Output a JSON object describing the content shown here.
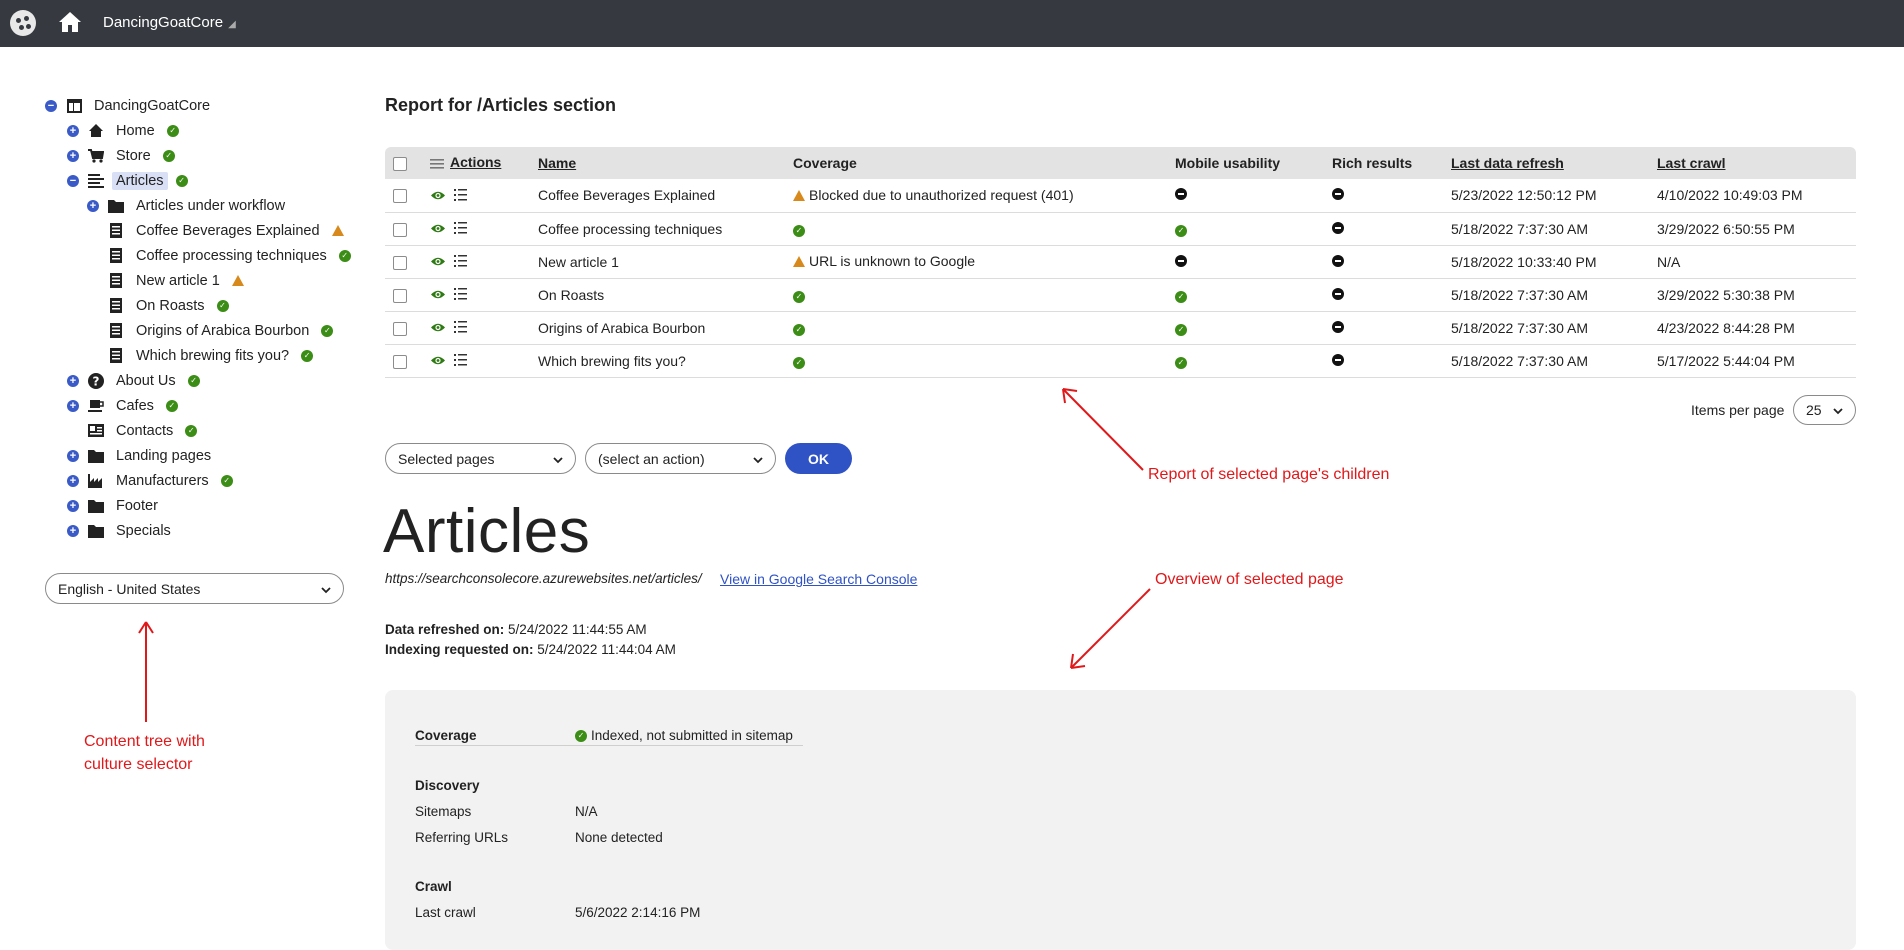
{
  "topbar": {
    "site_name": "DancingGoatCore",
    "caret": "◢"
  },
  "tree": {
    "root": "DancingGoatCore",
    "items": [
      {
        "label": "Home",
        "status": "ok"
      },
      {
        "label": "Store",
        "status": "ok"
      },
      {
        "label": "Articles",
        "status": "ok"
      },
      {
        "label": "Articles under workflow",
        "status": ""
      },
      {
        "label": "Coffee Beverages Explained",
        "status": "warn"
      },
      {
        "label": "Coffee processing techniques",
        "status": "ok"
      },
      {
        "label": "New article 1",
        "status": "warn"
      },
      {
        "label": "On Roasts",
        "status": "ok"
      },
      {
        "label": "Origins of Arabica Bourbon",
        "status": "ok"
      },
      {
        "label": "Which brewing fits you?",
        "status": "ok"
      },
      {
        "label": "About Us",
        "status": "ok"
      },
      {
        "label": "Cafes",
        "status": "ok"
      },
      {
        "label": "Contacts",
        "status": "ok"
      },
      {
        "label": "Landing pages",
        "status": ""
      },
      {
        "label": "Manufacturers",
        "status": "ok"
      },
      {
        "label": "Footer",
        "status": ""
      },
      {
        "label": "Specials",
        "status": ""
      }
    ],
    "culture": "English - United States"
  },
  "report": {
    "title": "Report for /Articles section",
    "columns": [
      "Actions",
      "Name",
      "Coverage",
      "Mobile usability",
      "Rich results",
      "Last data refresh",
      "Last crawl"
    ],
    "rows": [
      {
        "name": "Coffee Beverages Explained",
        "coverage": "Blocked due to unauthorized request (401)",
        "coverage_status": "warn",
        "mobile": "none",
        "rich": "none",
        "refresh": "5/23/2022 12:50:12 PM",
        "crawl": "4/10/2022 10:49:03 PM"
      },
      {
        "name": "Coffee processing techniques",
        "coverage": "",
        "coverage_status": "ok",
        "mobile": "ok",
        "rich": "none",
        "refresh": "5/18/2022 7:37:30 AM",
        "crawl": "3/29/2022 6:50:55 PM"
      },
      {
        "name": "New article 1",
        "coverage": "URL is unknown to Google",
        "coverage_status": "warn",
        "mobile": "none",
        "rich": "none",
        "refresh": "5/18/2022 10:33:40 PM",
        "crawl": "N/A"
      },
      {
        "name": "On Roasts",
        "coverage": "",
        "coverage_status": "ok",
        "mobile": "ok",
        "rich": "none",
        "refresh": "5/18/2022 7:37:30 AM",
        "crawl": "3/29/2022 5:30:38 PM"
      },
      {
        "name": "Origins of Arabica Bourbon",
        "coverage": "",
        "coverage_status": "ok",
        "mobile": "ok",
        "rich": "none",
        "refresh": "5/18/2022 7:37:30 AM",
        "crawl": "4/23/2022 8:44:28 PM"
      },
      {
        "name": "Which brewing fits you?",
        "coverage": "",
        "coverage_status": "ok",
        "mobile": "ok",
        "rich": "none",
        "refresh": "5/18/2022 7:37:30 AM",
        "crawl": "5/17/2022 5:44:04 PM"
      }
    ],
    "items_per_page_label": "Items per page",
    "items_per_page": "25"
  },
  "actions": {
    "scope": "Selected pages",
    "action": "(select an action)",
    "ok": "OK"
  },
  "page": {
    "title": "Articles",
    "url": "https://searchconsolecore.azurewebsites.net/articles/",
    "gsc_link": "View in Google Search Console",
    "refreshed_label": "Data refreshed on:",
    "refreshed_value": "5/24/2022 11:44:55 AM",
    "indexing_label": "Indexing requested on:",
    "indexing_value": "5/24/2022 11:44:04 AM"
  },
  "overview": {
    "coverage_label": "Coverage",
    "coverage_value": "Indexed, not submitted in sitemap",
    "discovery_label": "Discovery",
    "sitemaps_label": "Sitemaps",
    "sitemaps_value": "N/A",
    "referring_label": "Referring URLs",
    "referring_value": "None detected",
    "crawl_label": "Crawl",
    "last_crawl_label": "Last crawl",
    "last_crawl_value": "5/6/2022 2:14:16 PM"
  },
  "annotations": {
    "report": "Report of selected page's children",
    "overview": "Overview of selected page",
    "tree_line1": "Content tree with",
    "tree_line2": "culture selector"
  },
  "colors": {
    "topbar": "#363a40",
    "accent": "#2f52c5",
    "ok": "#3b8d16",
    "warn": "#d7891c",
    "annotation": "#e0181a"
  }
}
